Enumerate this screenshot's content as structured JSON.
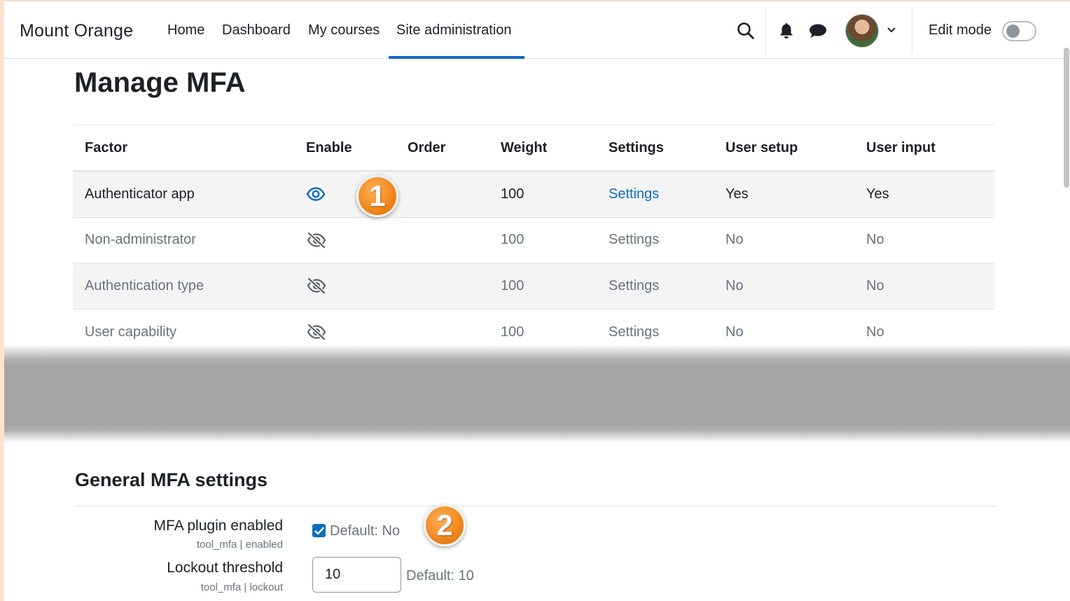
{
  "navbar": {
    "brand": "Mount Orange",
    "links": [
      "Home",
      "Dashboard",
      "My courses",
      "Site administration"
    ],
    "active_link": "Site administration",
    "edit_mode_label": "Edit mode",
    "edit_mode_on": false
  },
  "page": {
    "title": "Manage MFA"
  },
  "table": {
    "headers": [
      "Factor",
      "Enable",
      "Order",
      "Weight",
      "Settings",
      "User setup",
      "User input"
    ],
    "rows": [
      {
        "factor": "Authenticator app",
        "enabled": true,
        "order": "",
        "weight": "100",
        "settings": "Settings",
        "user_setup": "Yes",
        "user_input": "Yes"
      },
      {
        "factor": "Non-administrator",
        "enabled": false,
        "order": "",
        "weight": "100",
        "settings": "Settings",
        "user_setup": "No",
        "user_input": "No"
      },
      {
        "factor": "Authentication type",
        "enabled": false,
        "order": "",
        "weight": "100",
        "settings": "Settings",
        "user_setup": "No",
        "user_input": "No"
      },
      {
        "factor": "User capability",
        "enabled": false,
        "order": "",
        "weight": "100",
        "settings": "Settings",
        "user_setup": "No",
        "user_input": "No"
      }
    ]
  },
  "callouts": [
    "1",
    "2"
  ],
  "general": {
    "title": "General MFA settings",
    "plugin_enabled": {
      "label": "MFA plugin enabled",
      "key": "tool_mfa | enabled",
      "checked": true,
      "default": "Default: No"
    },
    "lockout": {
      "label": "Lockout threshold",
      "key": "tool_mfa | lockout",
      "value": "10",
      "default": "Default: 10"
    }
  },
  "colors": {
    "accent": "#0f6cbf",
    "callout": "#f28a1e",
    "muted_text": "#6a737b"
  },
  "icons": {
    "search": "search-icon",
    "notifications": "bell-icon",
    "messages": "chat-icon",
    "user_menu": "chevron-down-icon",
    "enabled": "eye-icon",
    "disabled": "eye-slash-icon"
  }
}
